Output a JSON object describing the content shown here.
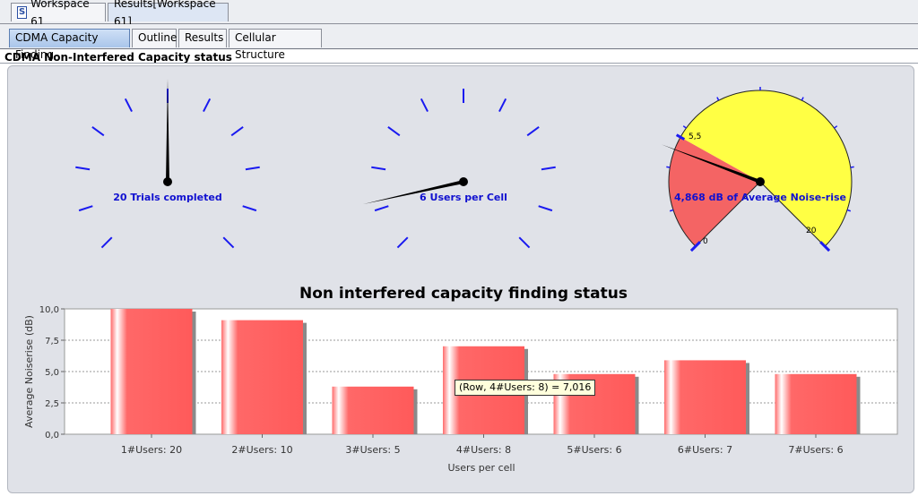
{
  "doc_tabs": [
    {
      "label": "Workspace 61",
      "active": false
    },
    {
      "label": "Results[Workspace 61]",
      "active": true
    }
  ],
  "sub_tabs": [
    {
      "label": "CDMA Capacity Finding",
      "active": true
    },
    {
      "label": "Outline",
      "active": false
    },
    {
      "label": "Results",
      "active": false
    },
    {
      "label": "Cellular Structure",
      "active": false
    }
  ],
  "section_title": "CDMA Non-Interfered Capacity status",
  "gauges": [
    {
      "label": "20 Trials completed",
      "value_fraction": 0.5
    },
    {
      "label": "6 Users per Cell",
      "value_fraction": 0.12
    },
    {
      "label": "4,868 dB of Average Noise-rise",
      "value_db": 4.868,
      "threshold_label": "5,5",
      "min_label": "0",
      "max_label": "20",
      "colors": {
        "low": "#f46464",
        "high": "#ffff44"
      }
    }
  ],
  "chart_data": {
    "type": "bar",
    "title": "Non interfered capacity finding status",
    "xlabel": "Users per cell",
    "ylabel": "Average Noiserise (dB)",
    "categories": [
      "1#Users: 20",
      "2#Users: 10",
      "3#Users: 5",
      "4#Users: 8",
      "5#Users: 6",
      "6#Users: 7",
      "7#Users: 6"
    ],
    "values": [
      10.0,
      9.1,
      3.8,
      7.016,
      4.8,
      5.9,
      4.8
    ],
    "ylim": [
      0,
      10
    ],
    "yticks": [
      "0,0",
      "2,5",
      "5,0",
      "7,5",
      "10,0"
    ],
    "grid": true,
    "bar_color": "#ff5a5a"
  },
  "tooltip": "(Row, 4#Users: 8) = 7,016"
}
